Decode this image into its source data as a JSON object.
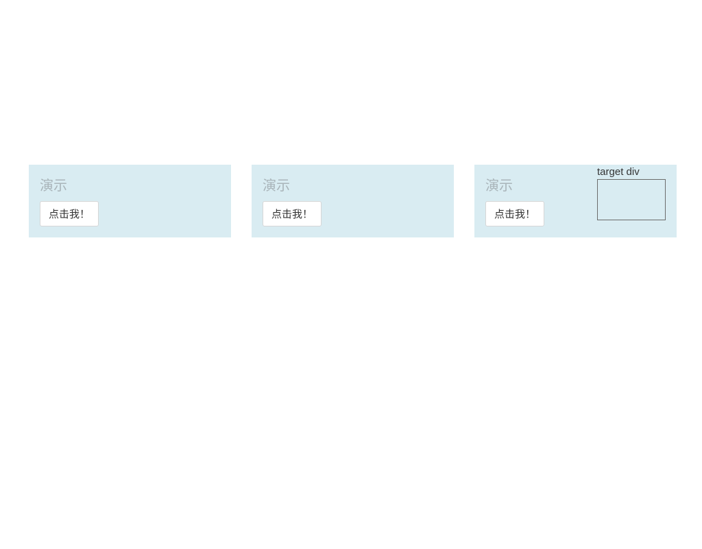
{
  "panels": [
    {
      "title": "演示",
      "button_label": "点击我！",
      "has_target": false
    },
    {
      "title": "演示",
      "button_label": "点击我！",
      "has_target": false
    },
    {
      "title": "演示",
      "button_label": "点击我！",
      "has_target": true,
      "target_label": "target div"
    }
  ]
}
